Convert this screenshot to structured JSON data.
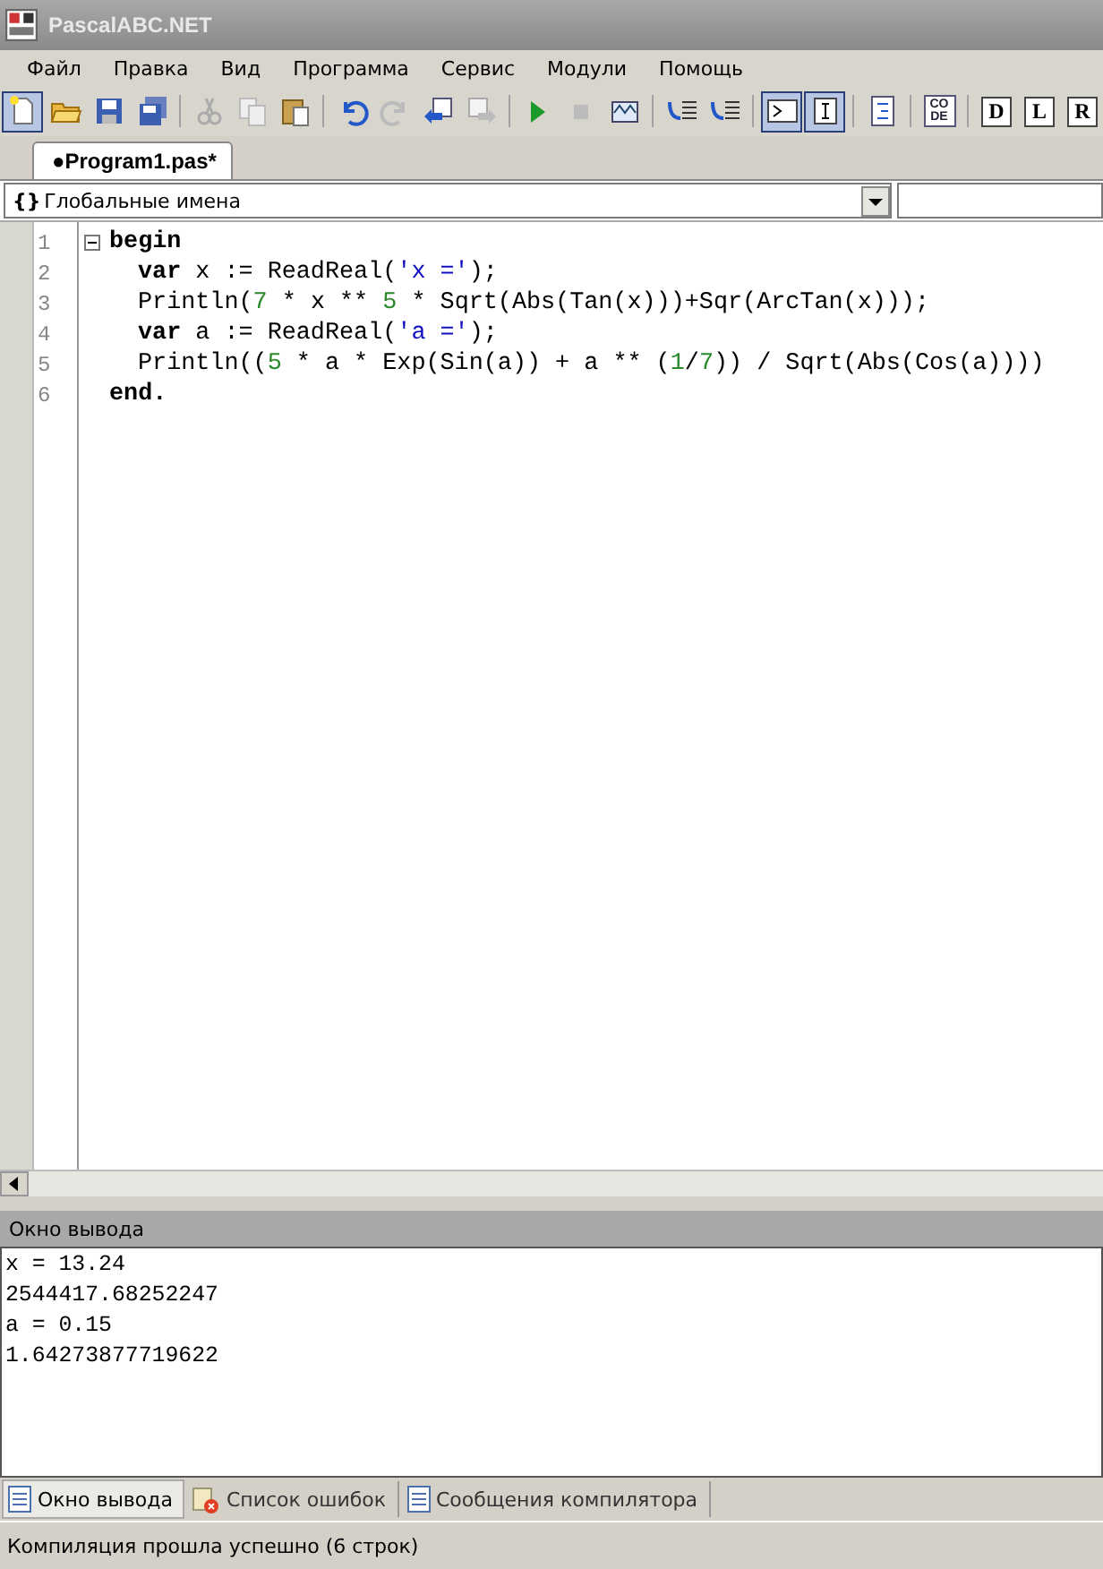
{
  "window": {
    "title": "PascalABC.NET"
  },
  "menu": [
    "Файл",
    "Правка",
    "Вид",
    "Программа",
    "Сервис",
    "Модули",
    "Помощь"
  ],
  "toolbar": [
    {
      "kind": "new",
      "on": true
    },
    {
      "kind": "open",
      "on": false
    },
    {
      "kind": "save",
      "on": false
    },
    {
      "kind": "saveall",
      "on": false
    },
    {
      "kind": "sep"
    },
    {
      "kind": "cut",
      "on": false
    },
    {
      "kind": "copy",
      "on": false
    },
    {
      "kind": "paste",
      "on": false
    },
    {
      "kind": "sep"
    },
    {
      "kind": "undo",
      "on": false
    },
    {
      "kind": "redo",
      "on": false
    },
    {
      "kind": "back",
      "on": false
    },
    {
      "kind": "fwd",
      "on": false
    },
    {
      "kind": "sep"
    },
    {
      "kind": "run",
      "on": false
    },
    {
      "kind": "stop",
      "on": false
    },
    {
      "kind": "build",
      "on": false
    },
    {
      "kind": "sep"
    },
    {
      "kind": "stepin",
      "on": false
    },
    {
      "kind": "stepover",
      "on": false
    },
    {
      "kind": "sep"
    },
    {
      "kind": "console",
      "on": true
    },
    {
      "kind": "input",
      "on": true
    },
    {
      "kind": "sep"
    },
    {
      "kind": "format",
      "on": false
    },
    {
      "kind": "sep"
    },
    {
      "kind": "code",
      "on": false,
      "text": "CO DE"
    },
    {
      "kind": "sep"
    },
    {
      "kind": "letter",
      "on": false,
      "text": "D"
    },
    {
      "kind": "letter",
      "on": false,
      "text": "L"
    },
    {
      "kind": "letter",
      "on": false,
      "text": "R"
    }
  ],
  "tabs": [
    {
      "label": "●Program1.pas*",
      "selected": true
    }
  ],
  "scope": {
    "icon_text": "{}",
    "value": "Глобальные имена"
  },
  "code": [
    {
      "number": "1",
      "indented": false,
      "tokens": [
        {
          "kind": "keyword",
          "text": "begin"
        }
      ]
    },
    {
      "number": "2",
      "indented": true,
      "tokens": [
        {
          "kind": "keyword",
          "text": "var"
        },
        {
          "kind": "plain",
          "text": " x := ReadReal("
        },
        {
          "kind": "string",
          "text": "'x ='"
        },
        {
          "kind": "plain",
          "text": ");"
        }
      ]
    },
    {
      "number": "3",
      "indented": true,
      "tokens": [
        {
          "kind": "plain",
          "text": "Println("
        },
        {
          "kind": "number",
          "text": "7"
        },
        {
          "kind": "plain",
          "text": " * x ** "
        },
        {
          "kind": "number",
          "text": "5"
        },
        {
          "kind": "plain",
          "text": " * Sqrt(Abs(Tan(x)))+Sqr(ArcTan(x)));"
        }
      ]
    },
    {
      "number": "4",
      "indented": true,
      "tokens": [
        {
          "kind": "keyword",
          "text": "var"
        },
        {
          "kind": "plain",
          "text": " a := ReadReal("
        },
        {
          "kind": "string",
          "text": "'a ='"
        },
        {
          "kind": "plain",
          "text": ");"
        }
      ]
    },
    {
      "number": "5",
      "indented": true,
      "tokens": [
        {
          "kind": "plain",
          "text": "Println(("
        },
        {
          "kind": "number",
          "text": "5"
        },
        {
          "kind": "plain",
          "text": " * a * Exp(Sin(a)) + a ** ("
        },
        {
          "kind": "number",
          "text": "1"
        },
        {
          "kind": "plain",
          "text": "/"
        },
        {
          "kind": "number",
          "text": "7"
        },
        {
          "kind": "plain",
          "text": ")) / Sqrt(Abs(Cos(a))))"
        }
      ]
    },
    {
      "number": "6",
      "indented": false,
      "tokens": [
        {
          "kind": "keyword",
          "text": "end."
        }
      ]
    }
  ],
  "output": {
    "title": "Окно вывода",
    "lines": [
      "x = 13.24",
      "2544417.68252247",
      "a = 0.15",
      "1.64273877719622"
    ]
  },
  "bottom_tabs": [
    {
      "label": "Окно вывода",
      "kind": "output",
      "selected": true
    },
    {
      "label": "Список ошибок",
      "kind": "errors",
      "selected": false
    },
    {
      "label": "Сообщения компилятора",
      "kind": "messages",
      "selected": false
    }
  ],
  "status_bar": "Компиляция прошла успешно (6 строк)"
}
